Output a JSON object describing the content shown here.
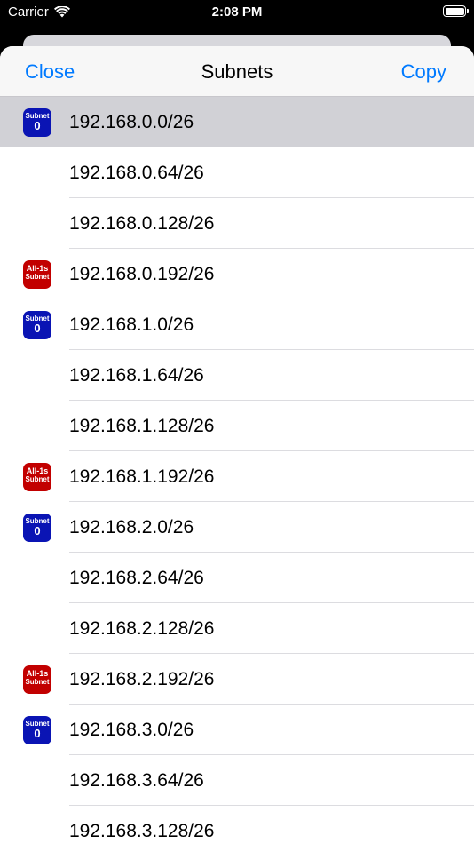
{
  "status_bar": {
    "carrier": "Carrier",
    "time": "2:08 PM",
    "battery_level": 1.0,
    "wifi_icon": "wifi-icon",
    "battery_icon": "battery-icon"
  },
  "nav": {
    "close_label": "Close",
    "title": "Subnets",
    "copy_label": "Copy"
  },
  "colors": {
    "accent": "#007aff",
    "subnet0_badge": "#0a14b4",
    "allones_badge": "#c20000",
    "selected_row": "#d1d1d6"
  },
  "badges": {
    "subnet0": {
      "line1": "Subnet",
      "line2": "0"
    },
    "allones": {
      "line1": "All-1s",
      "line2": "Subnet"
    }
  },
  "subnets": [
    {
      "address": "192.168.0.0/26",
      "badge": "subnet0",
      "selected": true
    },
    {
      "address": "192.168.0.64/26",
      "badge": ""
    },
    {
      "address": "192.168.0.128/26",
      "badge": ""
    },
    {
      "address": "192.168.0.192/26",
      "badge": "allones"
    },
    {
      "address": "192.168.1.0/26",
      "badge": "subnet0"
    },
    {
      "address": "192.168.1.64/26",
      "badge": ""
    },
    {
      "address": "192.168.1.128/26",
      "badge": ""
    },
    {
      "address": "192.168.1.192/26",
      "badge": "allones"
    },
    {
      "address": "192.168.2.0/26",
      "badge": "subnet0"
    },
    {
      "address": "192.168.2.64/26",
      "badge": ""
    },
    {
      "address": "192.168.2.128/26",
      "badge": ""
    },
    {
      "address": "192.168.2.192/26",
      "badge": "allones"
    },
    {
      "address": "192.168.3.0/26",
      "badge": "subnet0"
    },
    {
      "address": "192.168.3.64/26",
      "badge": ""
    },
    {
      "address": "192.168.3.128/26",
      "badge": ""
    }
  ]
}
